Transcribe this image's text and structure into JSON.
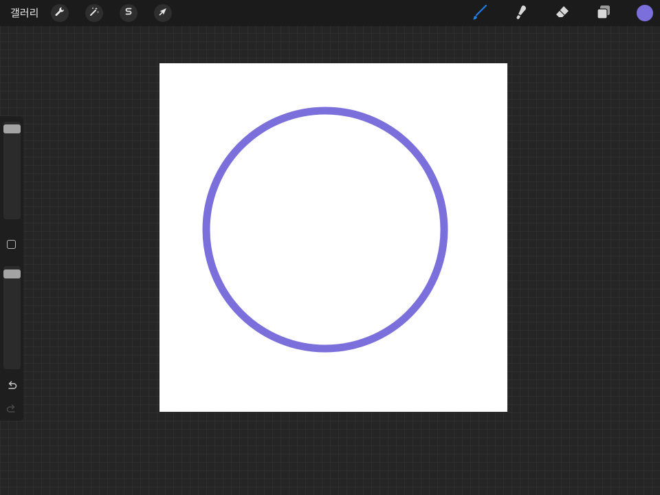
{
  "topbar": {
    "gallery_label": "갤러리",
    "left_tools": [
      {
        "name": "actions",
        "icon": "wrench-icon"
      },
      {
        "name": "adjustments",
        "icon": "magic-wand-icon"
      },
      {
        "name": "selection",
        "icon": "selection-s-icon"
      },
      {
        "name": "transform",
        "icon": "arrow-cursor-icon"
      }
    ],
    "right_tools": [
      {
        "name": "brush",
        "icon": "brush-icon",
        "active": true
      },
      {
        "name": "smudge",
        "icon": "smudge-finger-icon",
        "active": false
      },
      {
        "name": "eraser",
        "icon": "eraser-icon",
        "active": false
      },
      {
        "name": "layers",
        "icon": "layers-icon",
        "active": false
      }
    ],
    "current_color": "#7b6fdc"
  },
  "sidebar": {
    "brush_size": {
      "level": 1.0
    },
    "modify_button": {
      "icon": "square-modify-icon"
    },
    "opacity": {
      "level": 1.0
    },
    "undo_icon": "undo-icon",
    "redo_icon": "redo-icon"
  },
  "canvas": {
    "background": "#ffffff",
    "stroke": {
      "shape": "circle",
      "color": "#7b6fdc"
    }
  },
  "colors": {
    "active_tool": "#1f7de6",
    "inactive_tool": "#d8d8d8",
    "topbar_bg": "#1b1b1b",
    "workspace_bg": "#252525"
  }
}
